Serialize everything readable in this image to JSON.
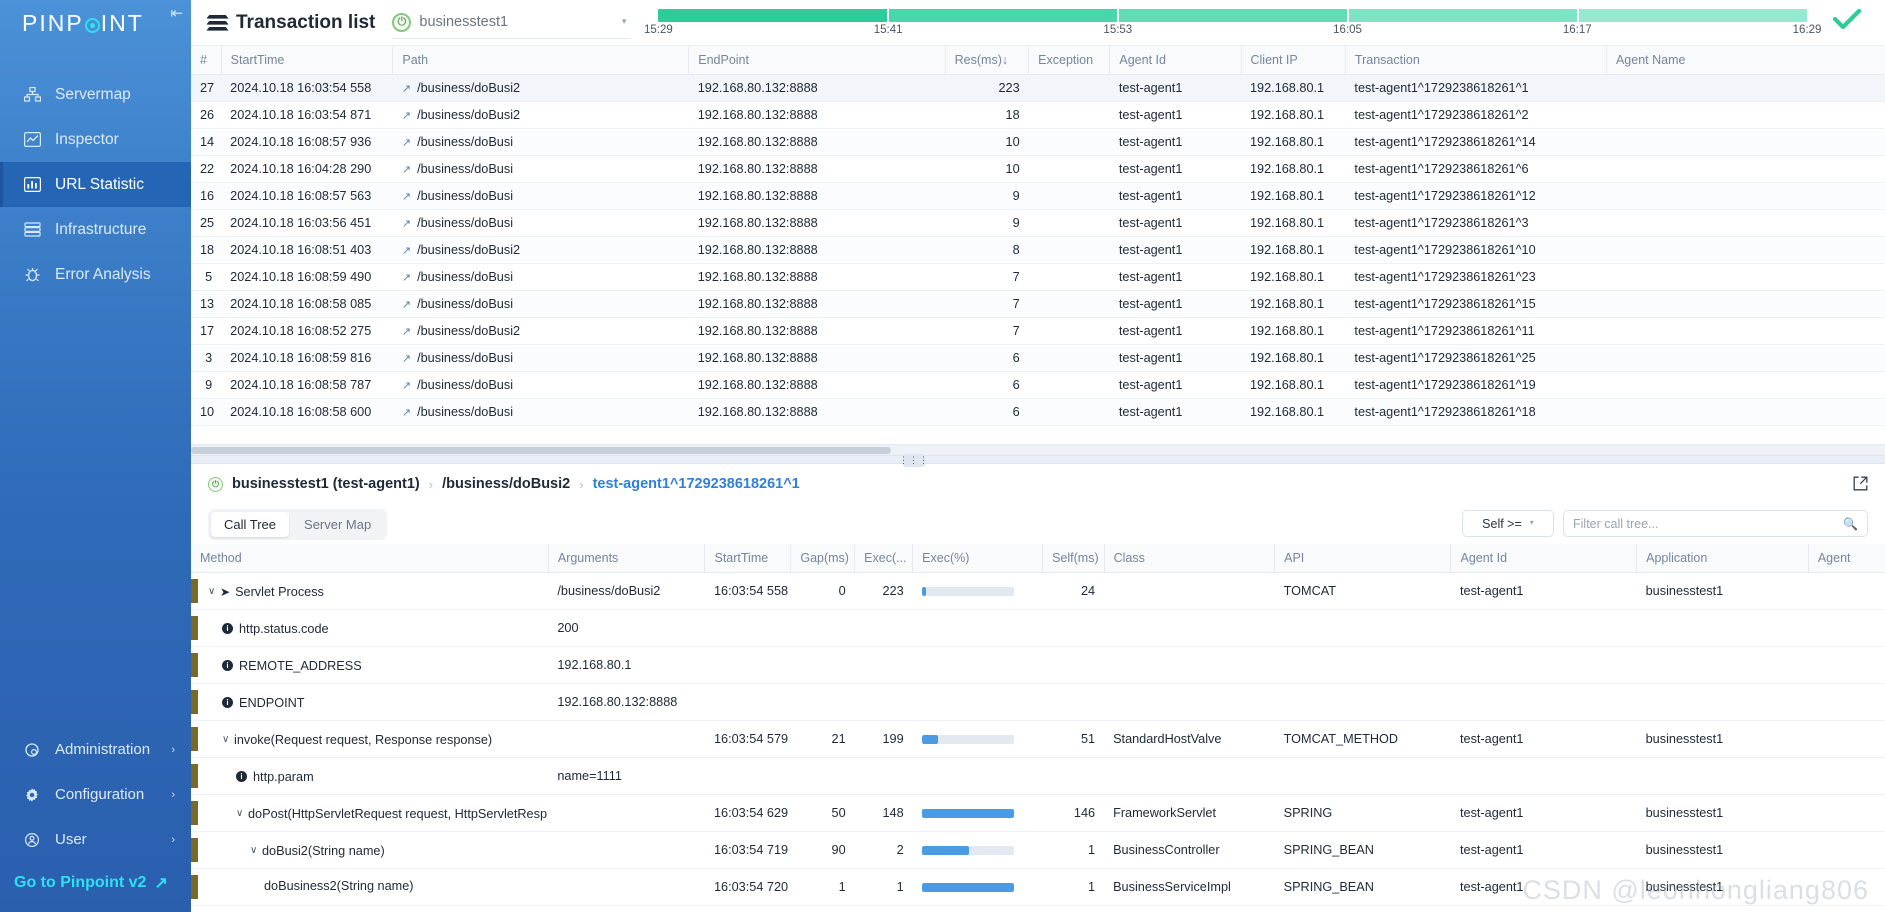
{
  "sidebar": {
    "brand": {
      "part1": "PINP",
      "part2": "INT"
    },
    "collapse_icon": "collapse-icon",
    "items": [
      {
        "label": "Servermap",
        "icon": "servermap-icon",
        "active": false
      },
      {
        "label": "Inspector",
        "icon": "inspector-icon",
        "active": false
      },
      {
        "label": "URL Statistic",
        "icon": "url-statistic-icon",
        "active": true
      },
      {
        "label": "Infrastructure",
        "icon": "infrastructure-icon",
        "active": false
      },
      {
        "label": "Error Analysis",
        "icon": "error-analysis-icon",
        "active": false
      }
    ],
    "bottom_items": [
      {
        "label": "Administration",
        "icon": "administration-icon",
        "caret": "›"
      },
      {
        "label": "Configuration",
        "icon": "gear-icon",
        "caret": "›"
      },
      {
        "label": "User",
        "icon": "user-icon",
        "caret": "›"
      }
    ],
    "goto_v2": "Go to Pinpoint v2"
  },
  "header": {
    "title": "Transaction list",
    "app_selector": {
      "value": "businesstest1",
      "icon": "spring-boot-icon"
    },
    "timeline": {
      "ticks": [
        "15:29",
        "15:41",
        "15:53",
        "16:05",
        "16:17",
        "16:29"
      ],
      "segment_colors": [
        "#2ecc9a",
        "#4ad6ab",
        "#63dcb6",
        "#7ee3c4",
        "#96e9d0"
      ],
      "check_icon": "check-icon",
      "check_color": "#2ecc9a"
    }
  },
  "transaction_table": {
    "columns": [
      "#",
      "StartTime",
      "Path",
      "EndPoint",
      "Res(ms)↓",
      "Exception",
      "Agent Id",
      "Client IP",
      "Transaction",
      "Agent Name"
    ],
    "rows": [
      {
        "num": "27",
        "start": "2024.10.18 16:03:54 558",
        "path": "/business/doBusi2",
        "endpoint": "192.168.80.132:8888",
        "res": "223",
        "exception": "",
        "agent": "test-agent1",
        "clientip": "192.168.80.1",
        "transaction": "test-agent1^1729238618261^1",
        "agentname": ""
      },
      {
        "num": "26",
        "start": "2024.10.18 16:03:54 871",
        "path": "/business/doBusi2",
        "endpoint": "192.168.80.132:8888",
        "res": "18",
        "exception": "",
        "agent": "test-agent1",
        "clientip": "192.168.80.1",
        "transaction": "test-agent1^1729238618261^2",
        "agentname": ""
      },
      {
        "num": "14",
        "start": "2024.10.18 16:08:57 936",
        "path": "/business/doBusi",
        "endpoint": "192.168.80.132:8888",
        "res": "10",
        "exception": "",
        "agent": "test-agent1",
        "clientip": "192.168.80.1",
        "transaction": "test-agent1^1729238618261^14",
        "agentname": ""
      },
      {
        "num": "22",
        "start": "2024.10.18 16:04:28 290",
        "path": "/business/doBusi",
        "endpoint": "192.168.80.132:8888",
        "res": "10",
        "exception": "",
        "agent": "test-agent1",
        "clientip": "192.168.80.1",
        "transaction": "test-agent1^1729238618261^6",
        "agentname": ""
      },
      {
        "num": "16",
        "start": "2024.10.18 16:08:57 563",
        "path": "/business/doBusi",
        "endpoint": "192.168.80.132:8888",
        "res": "9",
        "exception": "",
        "agent": "test-agent1",
        "clientip": "192.168.80.1",
        "transaction": "test-agent1^1729238618261^12",
        "agentname": ""
      },
      {
        "num": "25",
        "start": "2024.10.18 16:03:56 451",
        "path": "/business/doBusi",
        "endpoint": "192.168.80.132:8888",
        "res": "9",
        "exception": "",
        "agent": "test-agent1",
        "clientip": "192.168.80.1",
        "transaction": "test-agent1^1729238618261^3",
        "agentname": ""
      },
      {
        "num": "18",
        "start": "2024.10.18 16:08:51 403",
        "path": "/business/doBusi2",
        "endpoint": "192.168.80.132:8888",
        "res": "8",
        "exception": "",
        "agent": "test-agent1",
        "clientip": "192.168.80.1",
        "transaction": "test-agent1^1729238618261^10",
        "agentname": ""
      },
      {
        "num": "5",
        "start": "2024.10.18 16:08:59 490",
        "path": "/business/doBusi",
        "endpoint": "192.168.80.132:8888",
        "res": "7",
        "exception": "",
        "agent": "test-agent1",
        "clientip": "192.168.80.1",
        "transaction": "test-agent1^1729238618261^23",
        "agentname": ""
      },
      {
        "num": "13",
        "start": "2024.10.18 16:08:58 085",
        "path": "/business/doBusi",
        "endpoint": "192.168.80.132:8888",
        "res": "7",
        "exception": "",
        "agent": "test-agent1",
        "clientip": "192.168.80.1",
        "transaction": "test-agent1^1729238618261^15",
        "agentname": ""
      },
      {
        "num": "17",
        "start": "2024.10.18 16:08:52 275",
        "path": "/business/doBusi2",
        "endpoint": "192.168.80.132:8888",
        "res": "7",
        "exception": "",
        "agent": "test-agent1",
        "clientip": "192.168.80.1",
        "transaction": "test-agent1^1729238618261^11",
        "agentname": ""
      },
      {
        "num": "3",
        "start": "2024.10.18 16:08:59 816",
        "path": "/business/doBusi",
        "endpoint": "192.168.80.132:8888",
        "res": "6",
        "exception": "",
        "agent": "test-agent1",
        "clientip": "192.168.80.1",
        "transaction": "test-agent1^1729238618261^25",
        "agentname": ""
      },
      {
        "num": "9",
        "start": "2024.10.18 16:08:58 787",
        "path": "/business/doBusi",
        "endpoint": "192.168.80.132:8888",
        "res": "6",
        "exception": "",
        "agent": "test-agent1",
        "clientip": "192.168.80.1",
        "transaction": "test-agent1^1729238618261^19",
        "agentname": ""
      },
      {
        "num": "10",
        "start": "2024.10.18 16:08:58 600",
        "path": "/business/doBusi",
        "endpoint": "192.168.80.132:8888",
        "res": "6",
        "exception": "",
        "agent": "test-agent1",
        "clientip": "192.168.80.1",
        "transaction": "test-agent1^1729238618261^18",
        "agentname": ""
      }
    ]
  },
  "detail": {
    "breadcrumb": {
      "app": "businesstest1 (test-agent1)",
      "path": "/business/doBusi2",
      "transaction_id": "test-agent1^1729238618261^1",
      "separator": "›",
      "external_link_icon": "external-link-icon"
    },
    "tabs": [
      {
        "label": "Call Tree",
        "active": true
      },
      {
        "label": "Server Map",
        "active": false
      }
    ],
    "self_filter": {
      "label": "Self >="
    },
    "filter_input": {
      "placeholder": "Filter call tree...",
      "value": "",
      "icon": "search-icon"
    },
    "call_tree": {
      "columns": [
        "Method",
        "Arguments",
        "StartTime",
        "Gap(ms)",
        "Exec(...",
        "Exec(%)",
        "Self(ms)",
        "Class",
        "API",
        "Agent Id",
        "Application",
        "Agent"
      ],
      "rows": [
        {
          "depth": 0,
          "kind": "node",
          "caret": "∨",
          "icon": "arrow-icon",
          "method": "Servlet Process",
          "arguments": "/business/doBusi2",
          "start": "16:03:54 558",
          "gap": "0",
          "exec": "223",
          "exec_pct": 5,
          "self": "24",
          "class": "",
          "api": "TOMCAT",
          "agent": "test-agent1",
          "application": "businesstest1"
        },
        {
          "depth": 1,
          "kind": "annotation",
          "caret": "",
          "icon": "info-icon",
          "method": "http.status.code",
          "arguments": "200",
          "start": "",
          "gap": "",
          "exec": "",
          "exec_pct": null,
          "self": "",
          "class": "",
          "api": "",
          "agent": "",
          "application": ""
        },
        {
          "depth": 1,
          "kind": "annotation",
          "caret": "",
          "icon": "info-icon",
          "method": "REMOTE_ADDRESS",
          "arguments": "192.168.80.1",
          "start": "",
          "gap": "",
          "exec": "",
          "exec_pct": null,
          "self": "",
          "class": "",
          "api": "",
          "agent": "",
          "application": ""
        },
        {
          "depth": 1,
          "kind": "annotation",
          "caret": "",
          "icon": "info-icon",
          "method": "ENDPOINT",
          "arguments": "192.168.80.132:8888",
          "start": "",
          "gap": "",
          "exec": "",
          "exec_pct": null,
          "self": "",
          "class": "",
          "api": "",
          "agent": "",
          "application": ""
        },
        {
          "depth": 1,
          "kind": "node",
          "caret": "∨",
          "icon": "",
          "method": "invoke(Request request, Response response)",
          "arguments": "",
          "start": "16:03:54 579",
          "gap": "21",
          "exec": "199",
          "exec_pct": 18,
          "self": "51",
          "class": "StandardHostValve",
          "api": "TOMCAT_METHOD",
          "agent": "test-agent1",
          "application": "businesstest1"
        },
        {
          "depth": 2,
          "kind": "annotation",
          "caret": "",
          "icon": "info-icon",
          "method": "http.param",
          "arguments": "name=1111",
          "start": "",
          "gap": "",
          "exec": "",
          "exec_pct": null,
          "self": "",
          "class": "",
          "api": "",
          "agent": "",
          "application": ""
        },
        {
          "depth": 2,
          "kind": "node",
          "caret": "∨",
          "icon": "",
          "method": "doPost(HttpServletRequest request, HttpServletResp...",
          "arguments": "",
          "start": "16:03:54 629",
          "gap": "50",
          "exec": "148",
          "exec_pct": 100,
          "self": "146",
          "class": "FrameworkServlet",
          "api": "SPRING",
          "agent": "test-agent1",
          "application": "businesstest1"
        },
        {
          "depth": 3,
          "kind": "node",
          "caret": "∨",
          "icon": "",
          "method": "doBusi2(String name)",
          "arguments": "",
          "start": "16:03:54 719",
          "gap": "90",
          "exec": "2",
          "exec_pct": 52,
          "self": "1",
          "class": "BusinessController",
          "api": "SPRING_BEAN",
          "agent": "test-agent1",
          "application": "businesstest1"
        },
        {
          "depth": 4,
          "kind": "leaf",
          "caret": "",
          "icon": "",
          "method": "doBusiness2(String name)",
          "arguments": "",
          "start": "16:03:54 720",
          "gap": "1",
          "exec": "1",
          "exec_pct": 100,
          "self": "1",
          "class": "BusinessServiceImpl",
          "api": "SPRING_BEAN",
          "agent": "test-agent1",
          "application": "businesstest1"
        }
      ]
    }
  },
  "watermark": "CSDN @leonhongliang806",
  "colors": {
    "sidebar_top": "#4b92d8",
    "sidebar_bottom": "#2a5fae",
    "sidebar_active": "#2565b5",
    "accent_cyan": "#2ee0f2",
    "timeline_green": "#2ecc9a",
    "bar_blue": "#4a9ae4",
    "link_blue": "#2f80d8",
    "indicator_olive": "#7a6a2a"
  }
}
